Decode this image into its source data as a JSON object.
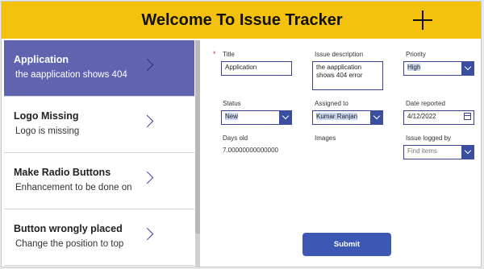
{
  "header": {
    "title": "Welcome To Issue Tracker"
  },
  "gallery": {
    "items": [
      {
        "title": "Application",
        "subtitle": "the aapplication shows 404",
        "selected": true
      },
      {
        "title": "Logo Missing",
        "subtitle": "Logo is missing"
      },
      {
        "title": "Make Radio Buttons",
        "subtitle": "Enhancement to be done on"
      },
      {
        "title": "Button wrongly placed",
        "subtitle": "Change the position to top"
      }
    ]
  },
  "form": {
    "required_marker": "*",
    "title_label": "Title",
    "title_value": "Application",
    "description_label": "Issue description",
    "description_value": "the aapplication shows 404 error",
    "priority_label": "Priority",
    "priority_value": "High",
    "status_label": "Status",
    "status_value": "New",
    "assigned_label": "Assigned to",
    "assigned_value": "Kumar Ranjan",
    "date_label": "Date reported",
    "date_value": "4/12/2022",
    "days_old_label": "Days old",
    "days_old_value": "7.00000000000000",
    "images_label": "Images",
    "logged_by_label": "Issue logged by",
    "logged_by_placeholder": "Find items",
    "submit_label": "Submit"
  },
  "colors": {
    "header_bg": "#f4c20d",
    "selected_item_bg": "#6064b0",
    "accent": "#3a4fa0",
    "submit_bg": "#3d58b4"
  },
  "icons": [
    "add-icon",
    "chevron-right-icon",
    "dropdown-chevron-icon",
    "calendar-icon"
  ]
}
